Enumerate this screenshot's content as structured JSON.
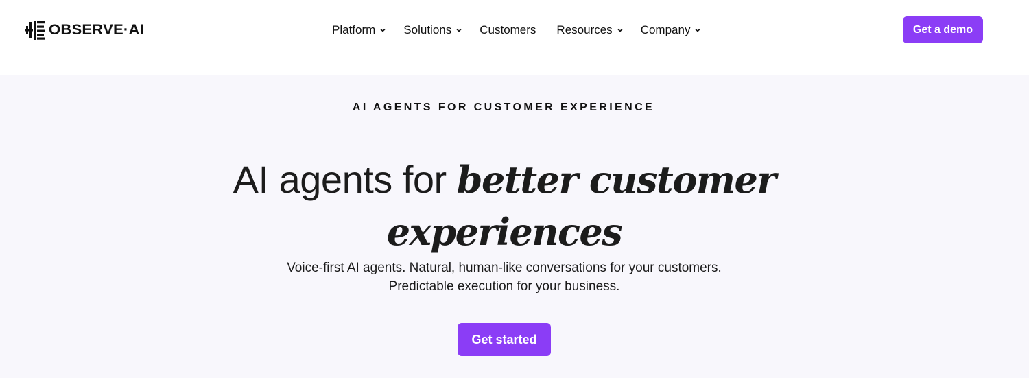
{
  "brand": {
    "logo_text": "OBSERVE·AI",
    "accent_color": "#8b3df6"
  },
  "nav": {
    "items": [
      {
        "label": "Platform",
        "has_dropdown": true
      },
      {
        "label": "Solutions",
        "has_dropdown": true
      },
      {
        "label": "Customers",
        "has_dropdown": false
      },
      {
        "label": "Resources",
        "has_dropdown": true
      },
      {
        "label": "Company",
        "has_dropdown": true
      }
    ],
    "cta_label": "Get a demo"
  },
  "hero": {
    "eyebrow": "AI AGENTS FOR CUSTOMER EXPERIENCE",
    "headline_plain": "AI agents for ",
    "headline_italic_1": "better customer",
    "headline_italic_2": "experiences",
    "subtitle_line1": "Voice-first AI agents. Natural, human-like conversations for your customers.",
    "subtitle_line2": "Predictable execution for your business.",
    "cta_label": "Get started"
  }
}
